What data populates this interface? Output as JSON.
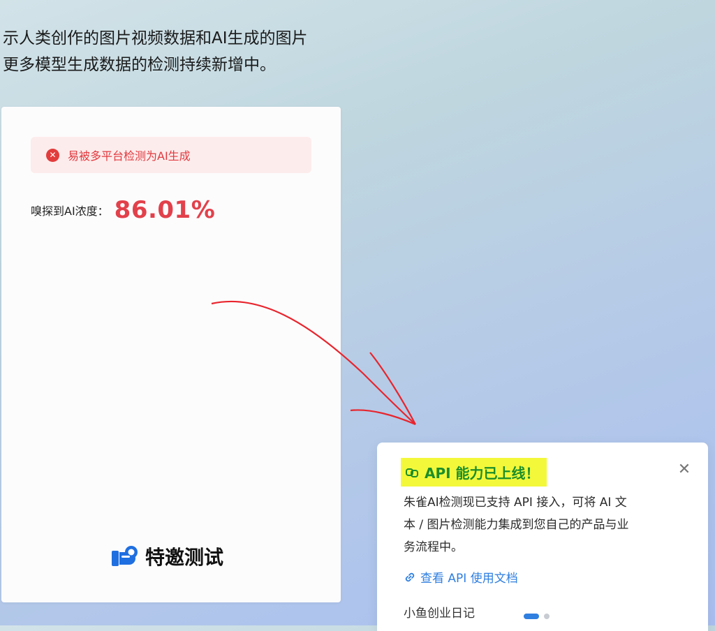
{
  "intro": {
    "line1": "示人类创作的图片视频数据和AI生成的图片",
    "line2": "更多模型生成数据的检测持续新增中。"
  },
  "result": {
    "alert_text": "易被多平台检测为AI生成",
    "score_label": "嗅探到AI浓度：",
    "score_value": "86.01%",
    "promo_text": "特邀测试"
  },
  "toast": {
    "title": "API 能力已上线！",
    "body_line1": "朱雀AI检测现已支持 API 接入，可将 AI 文",
    "body_line2": "本 / 图片检测能力集成到您自己的产品与业",
    "body_line3": "务流程中。",
    "link_text": "查看 API 使用文档",
    "footer_text": "小鱼创业日记"
  },
  "colors": {
    "alert_red": "#e0393e",
    "score_red": "#e2414b",
    "link_blue": "#2f7fe0",
    "highlight_yellow": "#f3f83a",
    "title_green": "#1b8e2a"
  },
  "icons": {
    "alert": "close-circle-icon",
    "promo": "pointing-hand-icon",
    "toast_title": "link-chain-icon",
    "toast_close": "close-icon",
    "link": "link-icon"
  }
}
